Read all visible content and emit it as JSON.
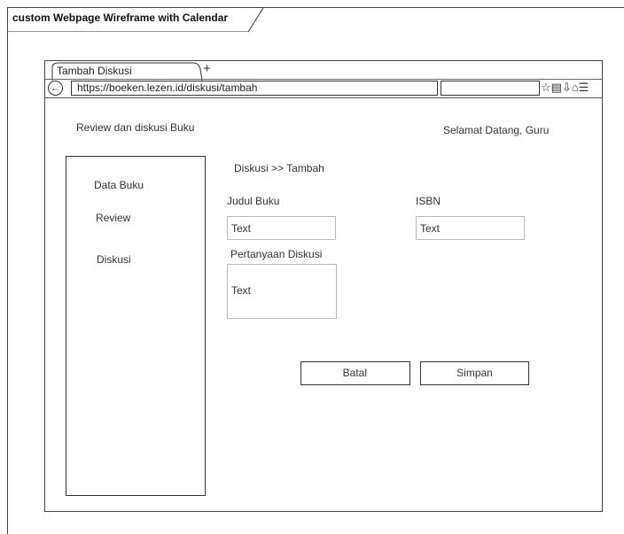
{
  "frame": {
    "title": "custom Webpage Wireframe with Calendar"
  },
  "browser": {
    "tab_label": "Tambah Diskusi",
    "new_tab": "+",
    "back_icon": "arrow-left-icon",
    "url": "https://boeken.lezen.id/diskusi/tambah",
    "toolbar_icons": "☆▤⇩⌂☰"
  },
  "page": {
    "app_title": "Review dan diskusi Buku",
    "welcome": "Selamat Datang, Guru",
    "breadcrumb": "Diskusi >> Tambah"
  },
  "sidebar": {
    "items": [
      {
        "label": "Data Buku"
      },
      {
        "label": "Review"
      },
      {
        "label": "Diskusi"
      }
    ]
  },
  "form": {
    "judul_label": "Judul Buku",
    "judul_value": "Text",
    "isbn_label": "ISBN",
    "isbn_value": "Text",
    "pertanyaan_label": "Pertanyaan Diskusi",
    "pertanyaan_value": "Text",
    "cancel_label": "Batal",
    "save_label": "Simpan"
  }
}
